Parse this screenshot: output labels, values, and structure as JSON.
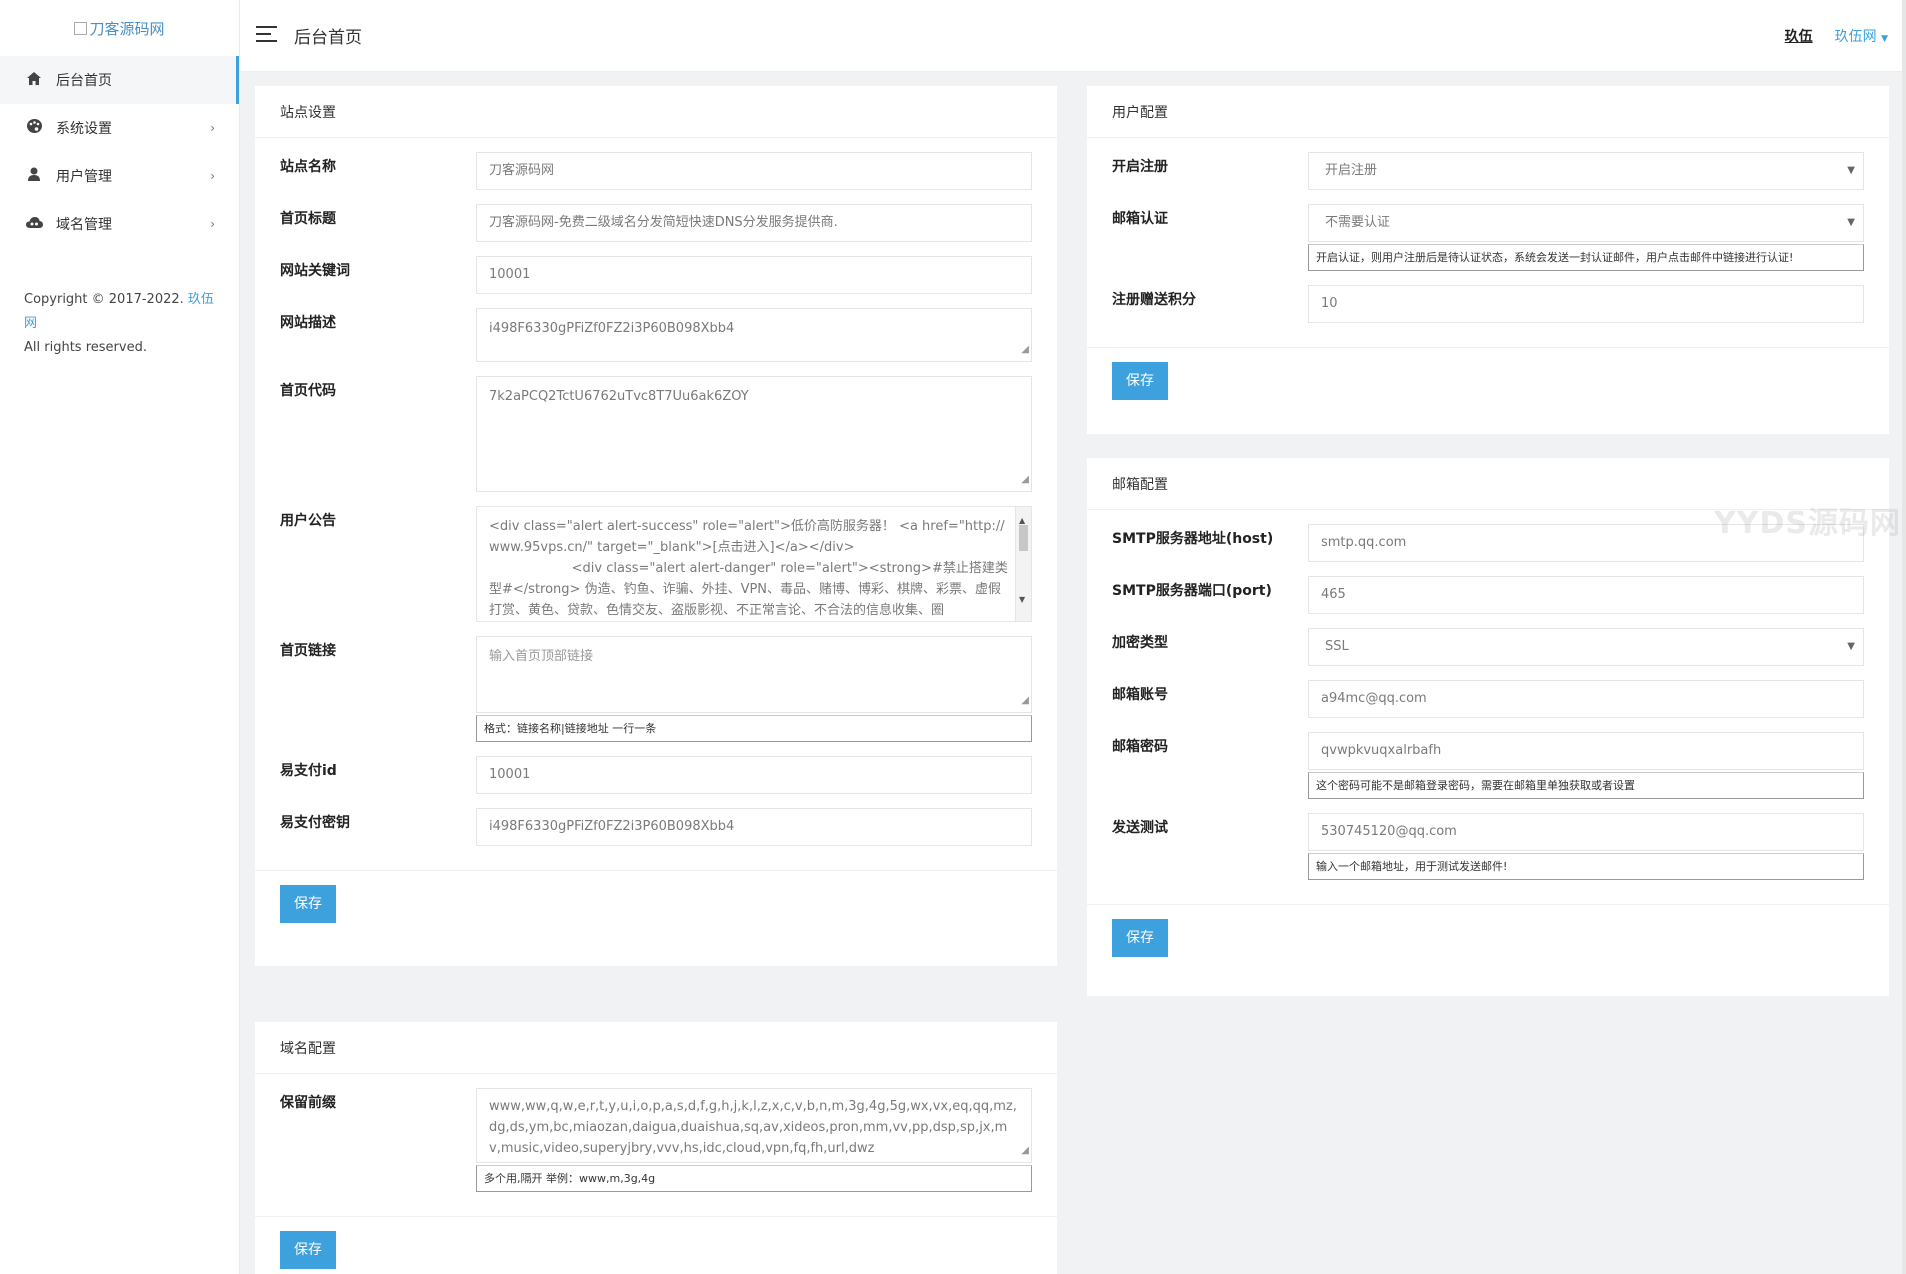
{
  "sidebar": {
    "logo_text": "刀客源码网",
    "items": [
      {
        "label": "后台首页"
      },
      {
        "label": "系统设置"
      },
      {
        "label": "用户管理"
      },
      {
        "label": "域名管理"
      }
    ],
    "copyright_line1": "Copyright © 2017-2022.",
    "copyright_link": "玖伍网",
    "copyright_line2": "All rights reserved."
  },
  "topbar": {
    "title": "后台首页",
    "nick": "玖伍",
    "user": "玖伍网"
  },
  "site": {
    "header": "站点设置",
    "fields": [
      {
        "label": "站点名称",
        "value": "刀客源码网"
      },
      {
        "label": "首页标题",
        "value": "刀客源码网-免费二级域名分发简短快速DNS分发服务提供商."
      },
      {
        "label": "网站关键词",
        "value": "10001"
      },
      {
        "label": "网站描述",
        "value": "i498F6330gPFiZf0FZ2i3P60B098Xbb4"
      },
      {
        "label": "首页代码",
        "value": "7k2aPCQ2TctU6762uTvc8T7Uu6ak6ZOY"
      },
      {
        "label": "用户公告",
        "value": "<div class=\"alert alert-success\" role=\"alert\">低价高防服务器！ <a href=\"http://www.95vps.cn/\" target=\"_blank\">[点击进入]</a></div>\n                    <div class=\"alert alert-danger\" role=\"alert\"><strong>#禁止搭建类型#</strong> 伪造、钓鱼、诈骗、外挂、VPN、毒品、赌博、博彩、棋牌、彩票、虚假打赏、黄色、贷款、色情交友、盗版影视、不正常言论、不合法的信息收集、圈"
      },
      {
        "label": "首页链接",
        "placeholder": "输入首页顶部链接",
        "help": "格式：链接名称|链接地址 一行一条"
      },
      {
        "label": "易支付id",
        "value": "10001"
      },
      {
        "label": "易支付密钥",
        "value": "i498F6330gPFiZf0FZ2i3P60B098Xbb4"
      }
    ],
    "save": "保存"
  },
  "domain": {
    "header": "域名配置",
    "label": "保留前缀",
    "value": "www,ww,q,w,e,r,t,y,u,i,o,p,a,s,d,f,g,h,j,k,l,z,x,c,v,b,n,m,3g,4g,5g,wx,vx,eq,qq,mz,dg,ds,ym,bc,miaozan,daigua,duaishua,sq,av,xideos,pron,mm,vv,pp,dsp,sp,jx,mv,music,video,superyjbry,vvv,hs,idc,cloud,vpn,fq,fh,url,dwz",
    "help": "多个用,隔开 举例：www,m,3g,4g",
    "save": "保存"
  },
  "user": {
    "header": "用户配置",
    "reg_label": "开启注册",
    "reg_value": "开启注册",
    "mail_label": "邮箱认证",
    "mail_value": "不需要认证",
    "mail_help": "开启认证，则用户注册后是待认证状态，系统会发送一封认证邮件，用户点击邮件中链接进行认证!",
    "points_label": "注册赠送积分",
    "points_value": "10",
    "save": "保存"
  },
  "mail": {
    "header": "邮箱配置",
    "host_label": "SMTP服务器地址(host)",
    "host_value": "smtp.qq.com",
    "port_label": "SMTP服务器端口(port)",
    "port_value": "465",
    "enc_label": "加密类型",
    "enc_value": "SSL",
    "account_label": "邮箱账号",
    "account_value": "a94mc@qq.com",
    "pass_label": "邮箱密码",
    "pass_value": "qvwpkvuqxalrbafh",
    "pass_help": "这个密码可能不是邮箱登录密码，需要在邮箱里单独获取或者设置",
    "test_label": "发送测试",
    "test_value": "530745120@qq.com",
    "test_help": "输入一个邮箱地址，用于测试发送邮件!",
    "save": "保存"
  },
  "watermark": "YYDS源码网"
}
